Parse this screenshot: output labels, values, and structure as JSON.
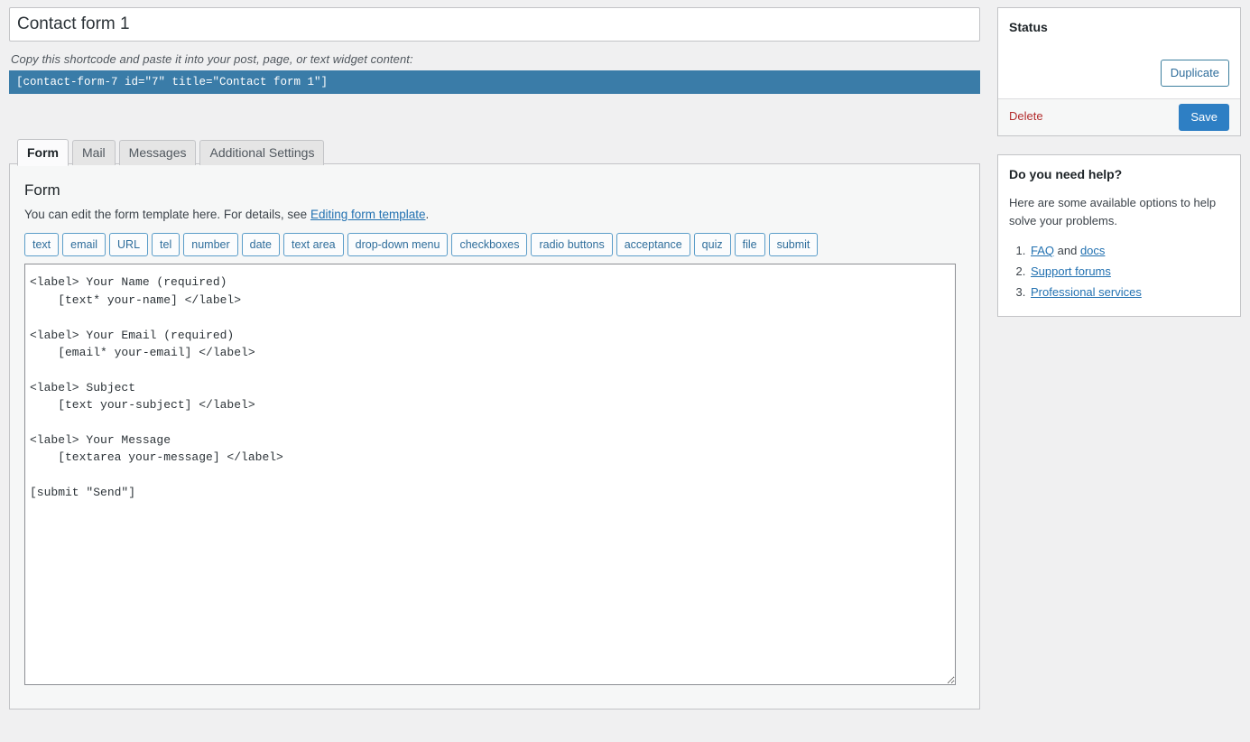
{
  "form_title": {
    "value": "Contact form 1"
  },
  "shortcode": {
    "hint": "Copy this shortcode and paste it into your post, page, or text widget content:",
    "value": "[contact-form-7 id=\"7\" title=\"Contact form 1\"]"
  },
  "tabs": [
    {
      "label": "Form",
      "active": true
    },
    {
      "label": "Mail",
      "active": false
    },
    {
      "label": "Messages",
      "active": false
    },
    {
      "label": "Additional Settings",
      "active": false
    }
  ],
  "panel": {
    "heading": "Form",
    "description_before": "You can edit the form template here. For details, see ",
    "description_link": "Editing form template",
    "description_after": "."
  },
  "tag_buttons": [
    "text",
    "email",
    "URL",
    "tel",
    "number",
    "date",
    "text area",
    "drop-down menu",
    "checkboxes",
    "radio buttons",
    "acceptance",
    "quiz",
    "file",
    "submit"
  ],
  "form_template": "<label> Your Name (required)\n    [text* your-name] </label>\n\n<label> Your Email (required)\n    [email* your-email] </label>\n\n<label> Subject\n    [text your-subject] </label>\n\n<label> Your Message\n    [textarea your-message] </label>\n\n[submit \"Send\"]",
  "status_panel": {
    "heading": "Status",
    "duplicate_label": "Duplicate",
    "delete_label": "Delete",
    "save_label": "Save"
  },
  "help_panel": {
    "heading": "Do you need help?",
    "intro": "Here are some available options to help solve your problems.",
    "items": [
      {
        "prefix": "",
        "link1": "FAQ",
        "middle": " and ",
        "link2": "docs",
        "suffix": ""
      },
      {
        "prefix": "",
        "link1": "Support forums",
        "middle": "",
        "link2": "",
        "suffix": ""
      },
      {
        "prefix": "",
        "link1": "Professional services",
        "middle": "",
        "link2": "",
        "suffix": ""
      }
    ]
  },
  "colors": {
    "accent_blue": "#2e7fc4",
    "shortcode_bg": "#3a7ca8",
    "delete_red": "#b32d2e",
    "link_blue": "#2271b1",
    "page_bg": "#f0f0f1"
  }
}
